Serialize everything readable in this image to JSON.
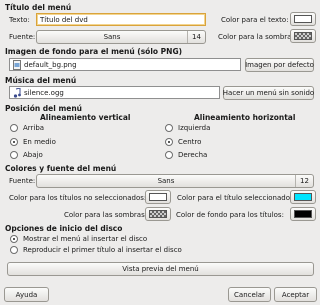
{
  "menu_title": {
    "section": "Título del menú",
    "text_label": "Texto:",
    "text_value": "Título del dvd",
    "font_label": "Fuente:",
    "font_name": "Sans",
    "font_size": "14",
    "text_color_label": "Color para el texto:",
    "shadow_color_label": "Color para la sombra:",
    "text_color": "#ffffff"
  },
  "background": {
    "section": "Imagen de fondo para el menú (sólo PNG)",
    "file": "default_bg.png",
    "default_button": "Imagen por defecto"
  },
  "music": {
    "section": "Música del menú",
    "file": "silence.ogg",
    "no_sound_button": "Hacer un menú sin sonido"
  },
  "position": {
    "section": "Posición del menú",
    "vertical_heading": "Alineamiento vertical",
    "horizontal_heading": "Alineamiento horizontal",
    "vertical_options": [
      "Arriba",
      "En medio",
      "Abajo"
    ],
    "vertical_selected": 1,
    "horizontal_options": [
      "Izquierda",
      "Centro",
      "Derecha"
    ],
    "horizontal_selected": 1
  },
  "colors": {
    "section": "Colores y fuente del menú",
    "font_label": "Fuente:",
    "font_name": "Sans",
    "font_size": "12",
    "unselected_label": "Color para los títulos no seleccionados:",
    "selected_label": "Color para el título seleccionado:",
    "shadow_label": "Color para las sombras:",
    "title_bg_label": "Color de fondo para los títulos:",
    "unselected_color": "#ffffff",
    "selected_color": "#00e5ff",
    "title_bg_color": "#000000"
  },
  "start": {
    "section": "Opciones de inicio del disco",
    "options": [
      "Mostrar el menú al insertar el disco",
      "Reproducir el primer título al insertar el disco"
    ],
    "selected": 0
  },
  "preview_button": "Vista previa del menú",
  "footer": {
    "help": "Ayuda",
    "cancel": "Cancelar",
    "accept": "Aceptar"
  }
}
